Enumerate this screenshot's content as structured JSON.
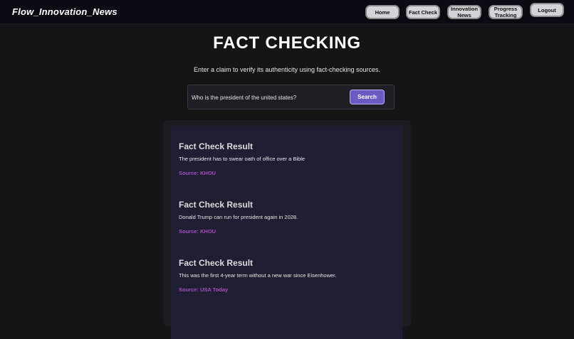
{
  "brand": "Flow_Innovation_News",
  "nav": {
    "home": "Home",
    "fact_check": "Fact Check",
    "innovation_news": "Innovation\nNews",
    "progress_tracking": "Progress\nTracking",
    "logout": "Logout"
  },
  "page": {
    "title": "FACT CHECKING",
    "subtitle": "Enter a claim to verify its authenticity using fact-checking sources."
  },
  "search": {
    "value": "Who is the president of the united states?",
    "button_label": "Search"
  },
  "results": [
    {
      "title": "Fact Check Result",
      "text": "The president has to swear oath of office over a Bible",
      "source": "Source: KHOU"
    },
    {
      "title": "Fact Check Result",
      "text": "Donald Trump can run for president again in 2028.",
      "source": "Source: KHOU"
    },
    {
      "title": "Fact Check Result",
      "text": "This was the first 4-year term without a new war since Eisenhower.",
      "source": "Source: USA Today"
    }
  ],
  "colors": {
    "navbar_bg": "#0b0b14",
    "page_bg": "#151515",
    "accent_button": "#6a5bc4",
    "source_text": "#a64fc2",
    "result_card_bg": "#201e32"
  }
}
